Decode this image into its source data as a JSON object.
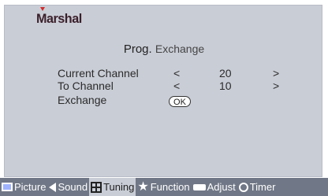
{
  "brand": {
    "logo_text": "Marshal"
  },
  "menu": {
    "title_part1": "Prog.",
    "title_part2": "Exchange",
    "rows": [
      {
        "label": "Current Channel",
        "left": "<",
        "value": "20",
        "right": ">"
      },
      {
        "label": "To Channel",
        "left": "<",
        "value": "10",
        "right": ">"
      },
      {
        "label": "Exchange",
        "button": "OK"
      }
    ]
  },
  "tabs": [
    {
      "label": "Picture",
      "icon": "picture-icon"
    },
    {
      "label": "Sound",
      "icon": "speaker-icon"
    },
    {
      "label": "Tuning",
      "icon": "tuning-icon",
      "active": true
    },
    {
      "label": "Function",
      "icon": "star-icon"
    },
    {
      "label": "Adjust",
      "icon": "adjust-icon"
    },
    {
      "label": "Timer",
      "icon": "timer-icon"
    }
  ]
}
